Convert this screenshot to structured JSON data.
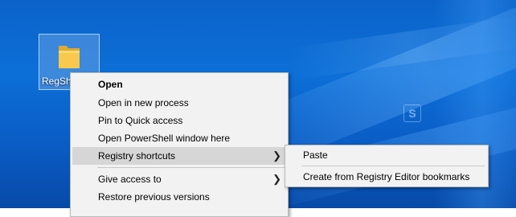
{
  "desktop": {
    "icon_label": "RegShot"
  },
  "context_menu": {
    "items": [
      {
        "label": "Open"
      },
      {
        "label": "Open in new process"
      },
      {
        "label": "Pin to Quick access"
      },
      {
        "label": "Open PowerShell window here"
      },
      {
        "label": "Registry shortcuts"
      },
      {
        "label": "Give access to"
      },
      {
        "label": "Restore previous versions"
      }
    ]
  },
  "submenu": {
    "items": [
      {
        "label": "Paste"
      },
      {
        "label": "Create from Registry Editor bookmarks"
      }
    ]
  },
  "colors": {
    "desktop_blue": "#0c6fd8",
    "menu_bg": "#f2f2f2",
    "hover_bg": "#d6d6d6",
    "folder_yellow": "#f8c94c"
  },
  "icons": [
    "folder-icon",
    "chevron-right-icon"
  ]
}
